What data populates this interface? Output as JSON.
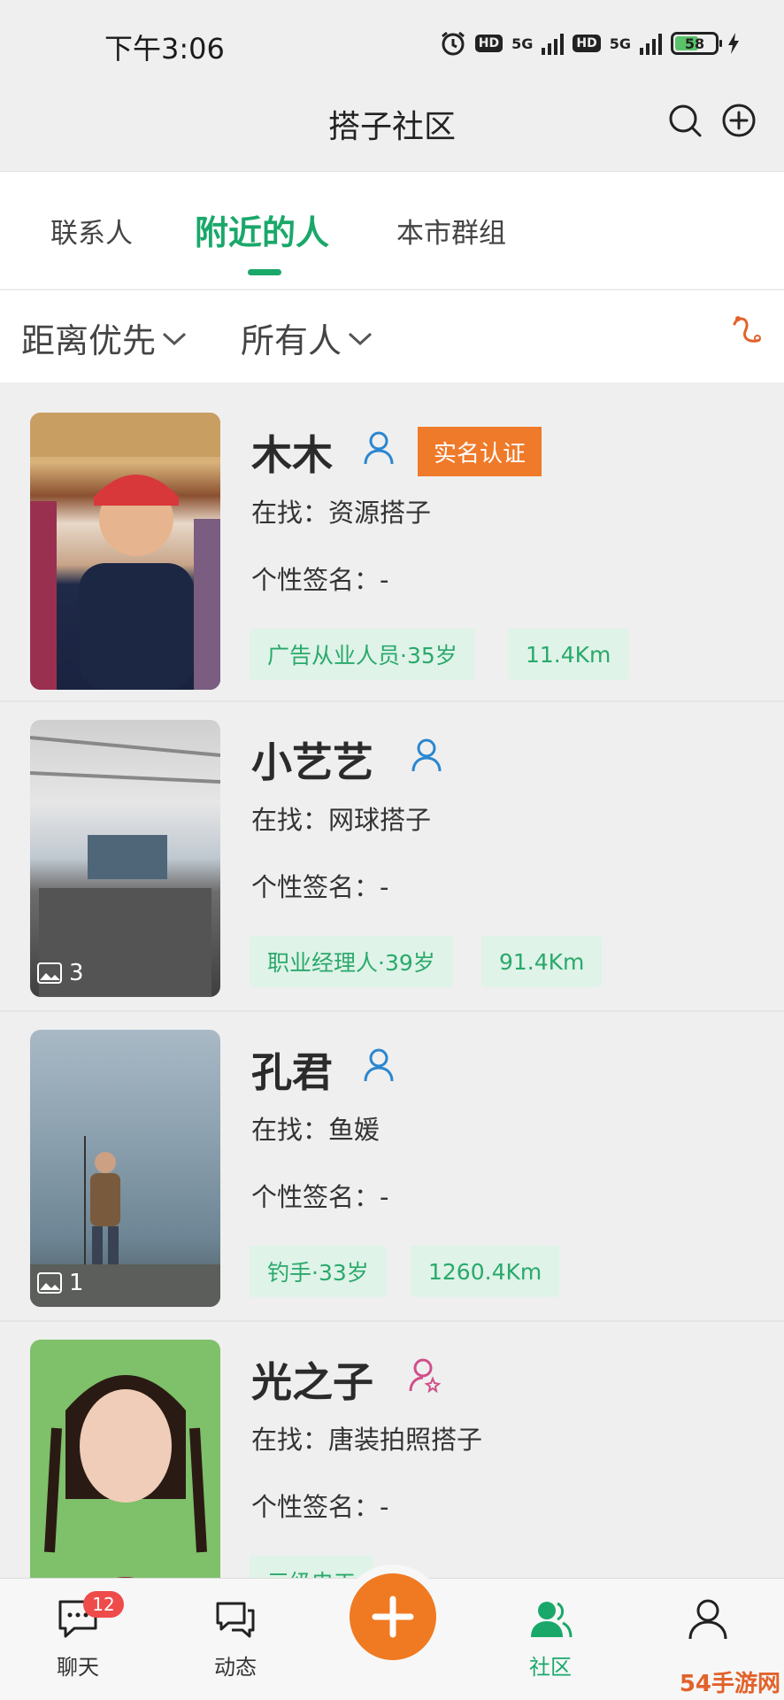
{
  "status": {
    "time": "下午3:06",
    "network1": "5G",
    "network2": "5G",
    "hd": "HD",
    "battery": "58"
  },
  "header": {
    "title": "搭子社区"
  },
  "tabs": [
    {
      "label": "联系人"
    },
    {
      "label": "附近的人",
      "active": true
    },
    {
      "label": "本市群组"
    }
  ],
  "filters": {
    "sort": "距离优先",
    "scope": "所有人"
  },
  "people": [
    {
      "name": "木木",
      "badge": "实名认证",
      "seeking": "在找：资源搭子",
      "signature": "个性签名：-",
      "tag": "广告从业人员·35岁",
      "distance": "11.4Km",
      "photo_count": ""
    },
    {
      "name": "小艺艺",
      "seeking": "在找：网球搭子",
      "signature": "个性签名：-",
      "tag": "职业经理人·39岁",
      "distance": "91.4Km",
      "photo_count": "3"
    },
    {
      "name": "孔君",
      "seeking": "在找：鱼媛",
      "signature": "个性签名：-",
      "tag": "钓手·33岁",
      "distance": "1260.4Km",
      "photo_count": "1"
    },
    {
      "name": "光之子",
      "seeking": "在找：唐装拍照搭子",
      "signature": "个性签名：-",
      "tag": "三级电工",
      "distance": "",
      "photo_count": ""
    }
  ],
  "nav": {
    "chat": "聊天",
    "chat_badge": "12",
    "moments": "动态",
    "community": "社区",
    "me": ""
  },
  "watermark": "54手游网",
  "colors": {
    "accent": "#1aa86a",
    "orange": "#ef7a22",
    "badge_red": "#ef4b4b"
  }
}
